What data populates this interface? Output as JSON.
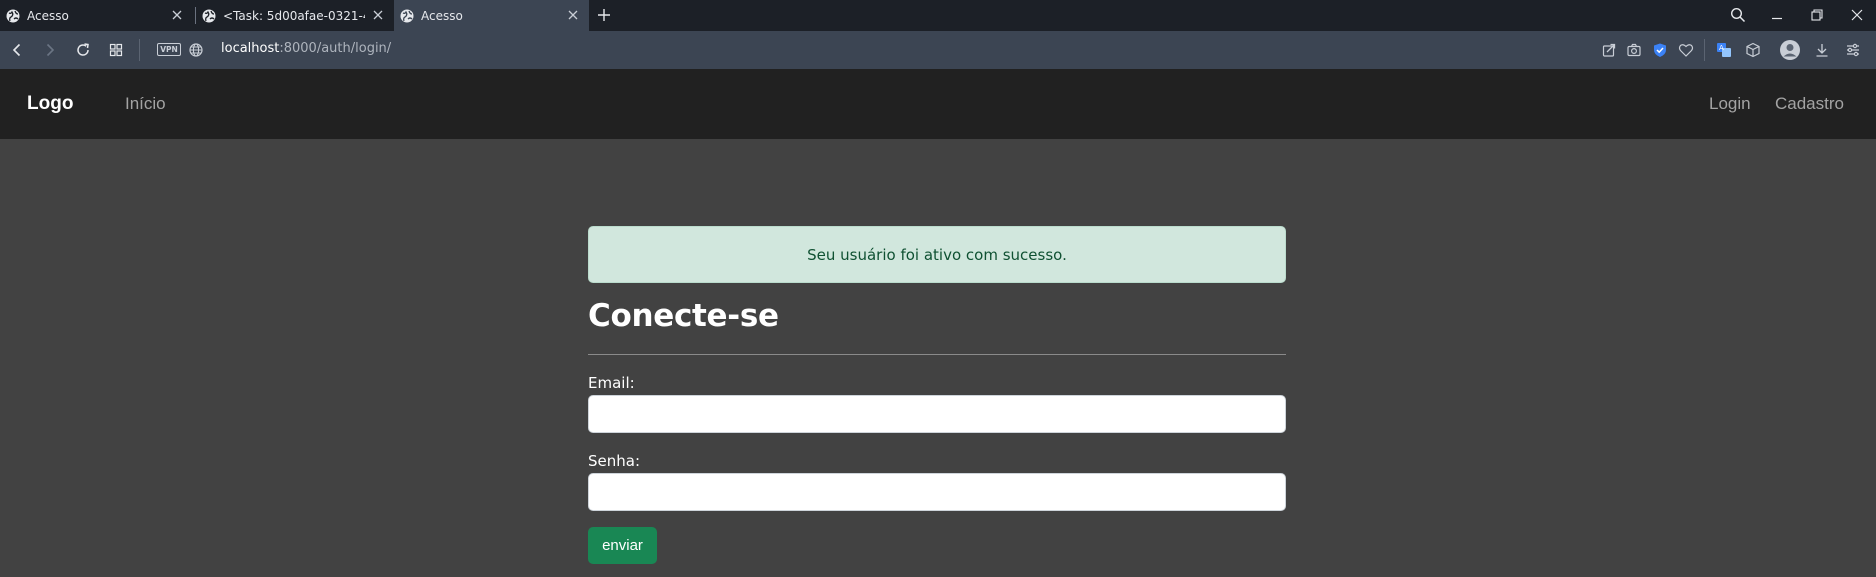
{
  "browser": {
    "tabs": [
      {
        "title": "Acesso",
        "active": false
      },
      {
        "title": "<Task: 5d00afae-0321-438",
        "active": false
      },
      {
        "title": "Acesso",
        "active": true
      }
    ],
    "address": {
      "host": "localhost",
      "path": ":8000/auth/login/",
      "vpn_label": "VPN"
    }
  },
  "navbar": {
    "brand": "Logo",
    "links": [
      "Início"
    ],
    "right_links": [
      "Login",
      "Cadastro"
    ]
  },
  "alert": {
    "message": "Seu usuário foi ativo com sucesso.",
    "bg_color": "#d1e7dd",
    "text_color": "#0f5132"
  },
  "form": {
    "title": "Conecte-se",
    "email_label": "Email:",
    "email_value": "",
    "password_label": "Senha:",
    "password_value": "",
    "submit_label": "enviar",
    "submit_color": "#198754"
  },
  "icons": [
    "globe-icon",
    "close-icon",
    "plus-icon",
    "search-icon",
    "minimize-icon",
    "restore-icon",
    "back-icon",
    "forward-icon",
    "reload-icon",
    "grid-icon",
    "share-icon",
    "camera-icon",
    "shield-icon",
    "heart-icon",
    "translate-icon",
    "cube-icon",
    "avatar-icon",
    "download-icon",
    "settings-icon"
  ]
}
